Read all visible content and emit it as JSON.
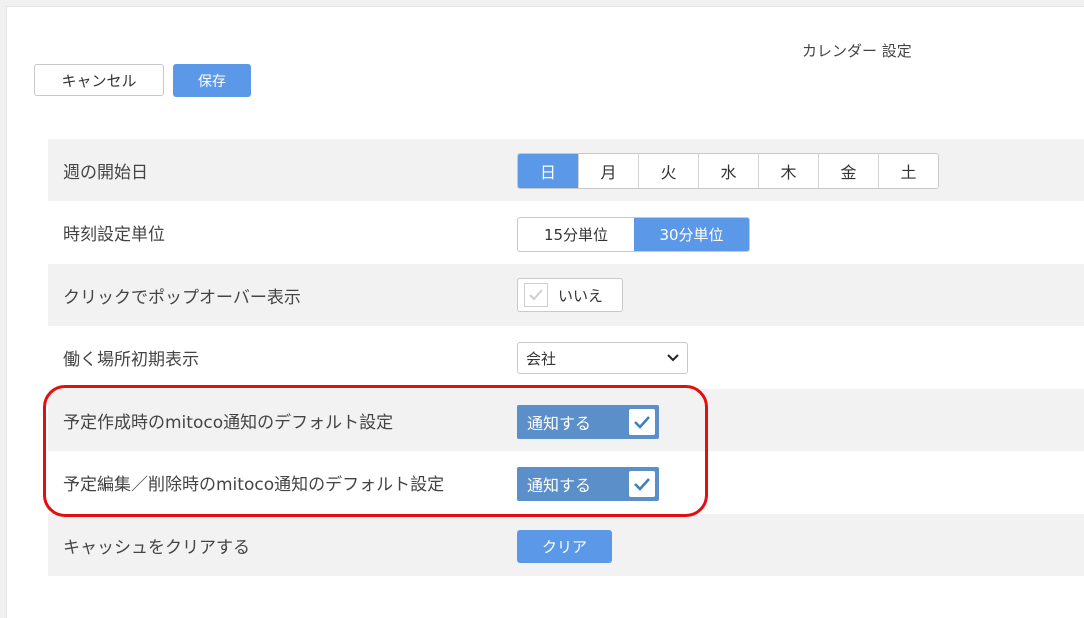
{
  "header": {
    "title": "カレンダー 設定",
    "cancel_label": "キャンセル",
    "save_label": "保存"
  },
  "settings": {
    "week_start": {
      "label": "週の開始日",
      "options": [
        "日",
        "月",
        "火",
        "水",
        "木",
        "金",
        "土"
      ],
      "selected": "日"
    },
    "time_unit": {
      "label": "時刻設定単位",
      "options": [
        "15分単位",
        "30分単位"
      ],
      "selected": "30分単位"
    },
    "popover": {
      "label": "クリックでポップオーバー表示",
      "value": "いいえ",
      "checked": false
    },
    "work_location": {
      "label": "働く場所初期表示",
      "value": "会社"
    },
    "notify_create": {
      "label": "予定作成時のmitoco通知のデフォルト設定",
      "value": "通知する",
      "checked": true
    },
    "notify_edit": {
      "label": "予定編集／削除時のmitoco通知のデフォルト設定",
      "value": "通知する",
      "checked": true
    },
    "cache": {
      "label": "キャッシュをクリアする",
      "button_label": "クリア"
    }
  },
  "colors": {
    "accent": "#5b99e8",
    "notify_bg": "#5b8fc9",
    "highlight": "#e01010",
    "row_shade": "#f2f2f2"
  }
}
